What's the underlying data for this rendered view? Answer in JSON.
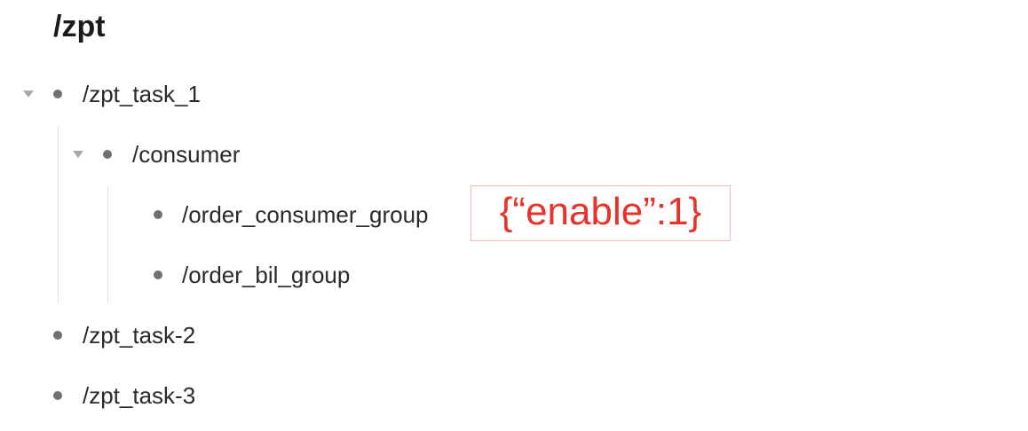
{
  "root": {
    "title": "/zpt"
  },
  "tree": {
    "task1": {
      "label": "/zpt_task_1"
    },
    "consumer": {
      "label": "/consumer"
    },
    "order_consumer_group": {
      "label": "/order_consumer_group"
    },
    "order_bil_group": {
      "label": "/order_bil_group"
    },
    "task2": {
      "label": "/zpt_task-2"
    },
    "task3": {
      "label": "/zpt_task-3"
    }
  },
  "annotation": {
    "text": "{“enable”:1}",
    "color": "#e8332a"
  },
  "colors": {
    "bullet": "#707070",
    "toggle": "#a8a8a8",
    "guide": "#e2e2e2",
    "text": "#2a2a2a"
  }
}
